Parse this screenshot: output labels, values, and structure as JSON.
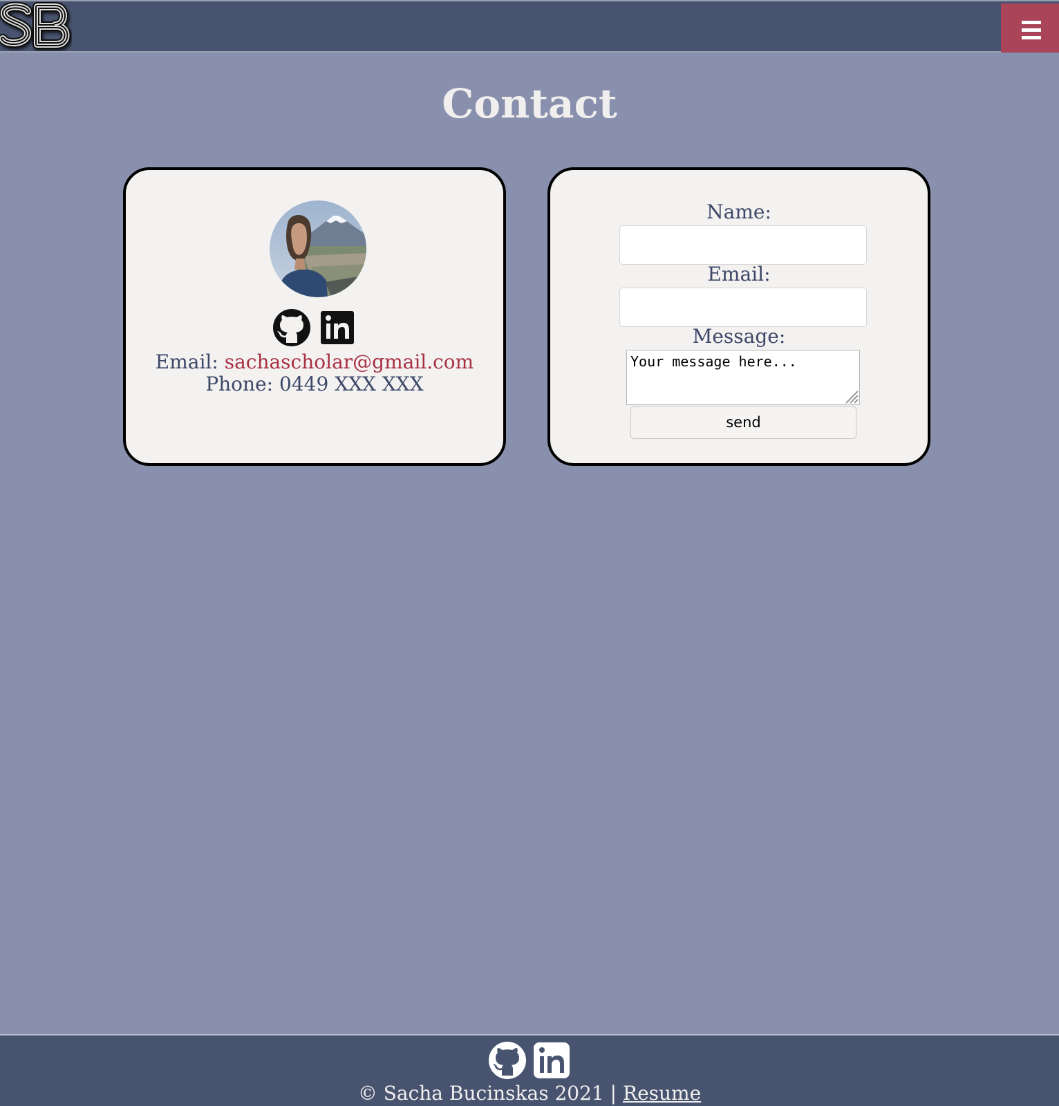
{
  "header": {
    "logo_text": "SB",
    "menu_icon": "hamburger-menu-icon"
  },
  "page": {
    "title": "Contact"
  },
  "profile_card": {
    "avatar_alt": "profile photo",
    "social_icons": [
      "github-icon",
      "linkedin-icon"
    ],
    "email_label": "Email:",
    "email_value": "sachascholar@gmail.com",
    "phone_label": "Phone:",
    "phone_value": "0449 XXX XXX"
  },
  "contact_form": {
    "name_label": "Name:",
    "name_value": "",
    "email_label": "Email:",
    "email_value": "",
    "message_label": "Message:",
    "message_placeholder": "Your message here...",
    "send_label": "send"
  },
  "footer": {
    "social_icons": [
      "github-icon",
      "linkedin-icon"
    ],
    "copyright": "© Sacha Bucinskas 2021 |",
    "resume_link": "Resume"
  },
  "colors": {
    "background": "#8990ad",
    "header_footer": "#48536f",
    "accent": "#a94459",
    "card": "#f3f2f1",
    "text": "#3d4767",
    "link": "#a83043"
  }
}
